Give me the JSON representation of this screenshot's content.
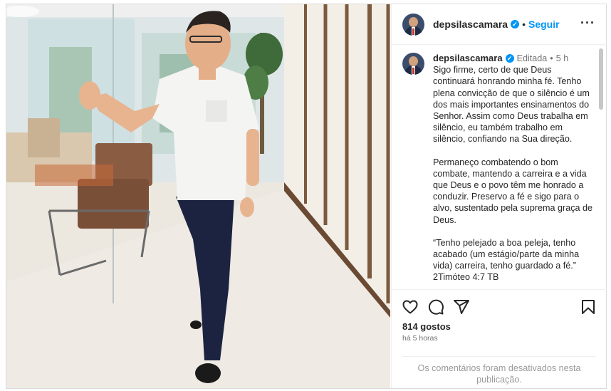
{
  "post": {
    "username": "depsilascamara",
    "follow_label": "Seguir",
    "edited_label": "Editada",
    "age": "5 h",
    "caption_paragraphs": [
      "Sigo firme, certo de que Deus continuará honrando minha fé. Tenho plena convicção de que o silêncio é um dos mais importantes ensinamentos do Senhor. Assim como Deus trabalha em silêncio, eu também trabalho em silêncio, confiando na Sua direção.",
      "Permaneço combatendo o bom combate, mantendo a carreira e a vida que Deus e o povo têm me honrado a conduzir. Preservo a fé e sigo para o alvo, sustentado pela suprema graça de Deus.",
      "“Tenho pelejado a boa peleja, tenho acabado (um estágio/parte da minha vida) carreira, tenho guardado a fé.” 2Timóteo 4:7 TB"
    ],
    "likes": "814 gostos",
    "time_ago": "há 5 horas",
    "comments_disabled": "Os comentários foram desativados nesta publicação."
  },
  "icons": {
    "verified": "verified-badge-icon",
    "more": "more-options-icon",
    "like": "heart-icon",
    "comment": "comment-icon",
    "share": "share-icon",
    "save": "bookmark-icon"
  },
  "colors": {
    "accent": "#0095f6",
    "text": "#262626",
    "muted": "#737373",
    "border": "#dbdbdb"
  }
}
